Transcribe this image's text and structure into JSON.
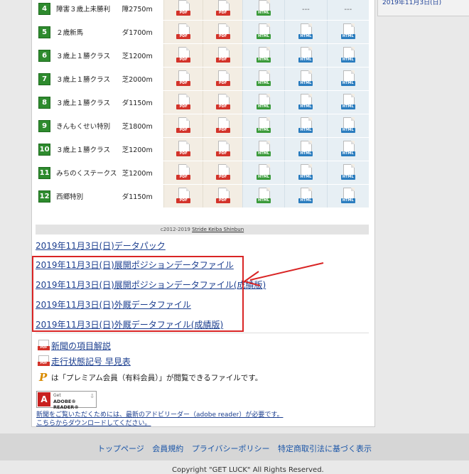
{
  "sidebar": {
    "partial_text": "2019年11月3日(日)"
  },
  "races": [
    {
      "num": "4",
      "name": "障害３歳上未勝利",
      "dist": "障2750m",
      "c4": "---",
      "c5": "---"
    },
    {
      "num": "5",
      "name": "２歳新馬",
      "dist": "ダ1700m"
    },
    {
      "num": "6",
      "name": "３歳上１勝クラス",
      "dist": "芝1200m"
    },
    {
      "num": "7",
      "name": "３歳上１勝クラス",
      "dist": "芝2000m"
    },
    {
      "num": "8",
      "name": "３歳上１勝クラス",
      "dist": "ダ1150m"
    },
    {
      "num": "9",
      "name": "きんもくせい特別",
      "dist": "芝1800m"
    },
    {
      "num": "10",
      "name": "３歳上１勝クラス",
      "dist": "芝1200m"
    },
    {
      "num": "11",
      "name": "みちのくステークス",
      "dist": "芝1200m"
    },
    {
      "num": "12",
      "name": "西郷特別",
      "dist": "ダ1150m"
    }
  ],
  "icons": {
    "pdf": "PDF",
    "html": "HTML"
  },
  "copyright_prefix": "c2012-2019 ",
  "copyright_link": "Stride Keiba Shinbun",
  "links": {
    "datapack": "2019年11月3日(日)データパック",
    "tenkai": "2019年11月3日(日)展開ポジションデータファイル",
    "tenkai_result": "2019年11月3日(日)展開ポジションデータファイル(成績版)",
    "gaikyu": "2019年11月3日(日)外厩データファイル",
    "gaikyu_result": "2019年11月3日(日)外厩データファイル(成績版)"
  },
  "help": {
    "items_link": "新聞の項目解説",
    "run_link": "走行状態記号 早見表",
    "premium_icon": "P",
    "premium_note": "は「プレミアム会員（有料会員）」が閲覧できるファイルです。"
  },
  "adobe": {
    "get": "Get",
    "name": "ADOBE® READER®",
    "logo": "A"
  },
  "reader_note1": "新聞をご覧いただくためには、最新のアドビリーダー（adobe reader）が必要です。",
  "reader_note2": "こちらからダウンロードしてください。",
  "footer": {
    "links": [
      "トップページ",
      "会員規約",
      "プライバシーポリシー",
      "特定商取引法に基づく表示"
    ],
    "copyright": "Copyright \"GET LUCK\" All Rights Reserved."
  },
  "colors": {
    "red_annotation": "#d92525",
    "link": "#1b3e8f",
    "race_number_bg": "#2e8b2e"
  }
}
